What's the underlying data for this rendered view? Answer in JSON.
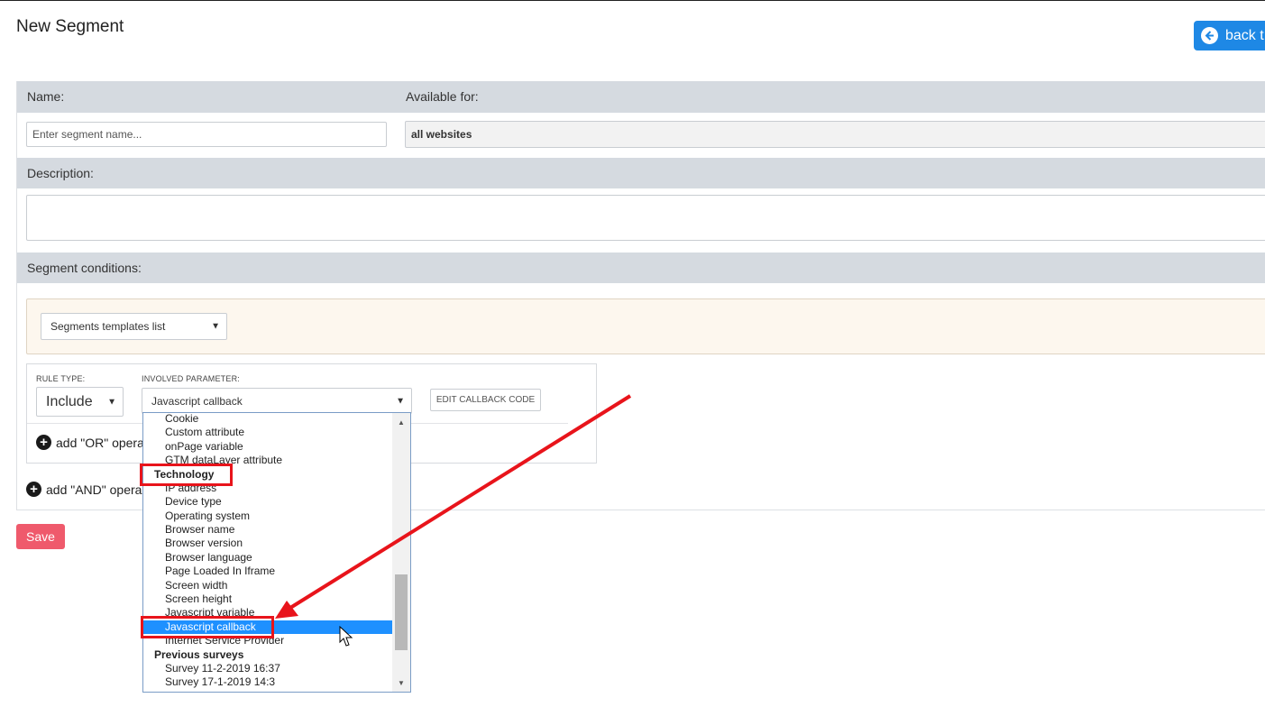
{
  "header": {
    "title": "New Segment",
    "back_label": "back t"
  },
  "form": {
    "name_label": "Name:",
    "name_placeholder": "Enter segment name...",
    "available_label": "Available for:",
    "available_value": "all websites",
    "description_label": "Description:",
    "conditions_label": "Segment conditions:",
    "templates_select": "Segments templates list"
  },
  "rule": {
    "rule_type_label": "RULE TYPE:",
    "rule_type_value": "Include",
    "param_label": "INVOLVED PARAMETER:",
    "param_value": "Javascript callback",
    "edit_callback_label": "EDIT CALLBACK CODE",
    "add_or_label": "add \"OR\" opera",
    "add_and_label": "add \"AND\" opera"
  },
  "save_label": "Save",
  "dropdown": {
    "items": [
      {
        "label": "Cookie",
        "kind": "opt"
      },
      {
        "label": "Custom attribute",
        "kind": "opt"
      },
      {
        "label": "onPage variable",
        "kind": "opt"
      },
      {
        "label": "GTM dataLayer attribute",
        "kind": "opt"
      },
      {
        "label": "Technology",
        "kind": "grp"
      },
      {
        "label": "IP address",
        "kind": "opt"
      },
      {
        "label": "Device type",
        "kind": "opt"
      },
      {
        "label": "Operating system",
        "kind": "opt"
      },
      {
        "label": "Browser name",
        "kind": "opt"
      },
      {
        "label": "Browser version",
        "kind": "opt"
      },
      {
        "label": "Browser language",
        "kind": "opt"
      },
      {
        "label": "Page Loaded In Iframe",
        "kind": "opt"
      },
      {
        "label": "Screen width",
        "kind": "opt"
      },
      {
        "label": "Screen height",
        "kind": "opt"
      },
      {
        "label": "Javascript variable",
        "kind": "opt"
      },
      {
        "label": "Javascript callback",
        "kind": "opt",
        "selected": true
      },
      {
        "label": "Internet Service Provider",
        "kind": "opt"
      },
      {
        "label": "Previous surveys",
        "kind": "grp"
      },
      {
        "label": "Survey 11-2-2019 16:37",
        "kind": "opt"
      },
      {
        "label": "Survey 17-1-2019 14:3",
        "kind": "opt"
      }
    ]
  },
  "colors": {
    "accent": "#1e88e5",
    "save": "#ef5a6c",
    "highlight": "#e8141b",
    "selected_option": "#1e90ff"
  }
}
